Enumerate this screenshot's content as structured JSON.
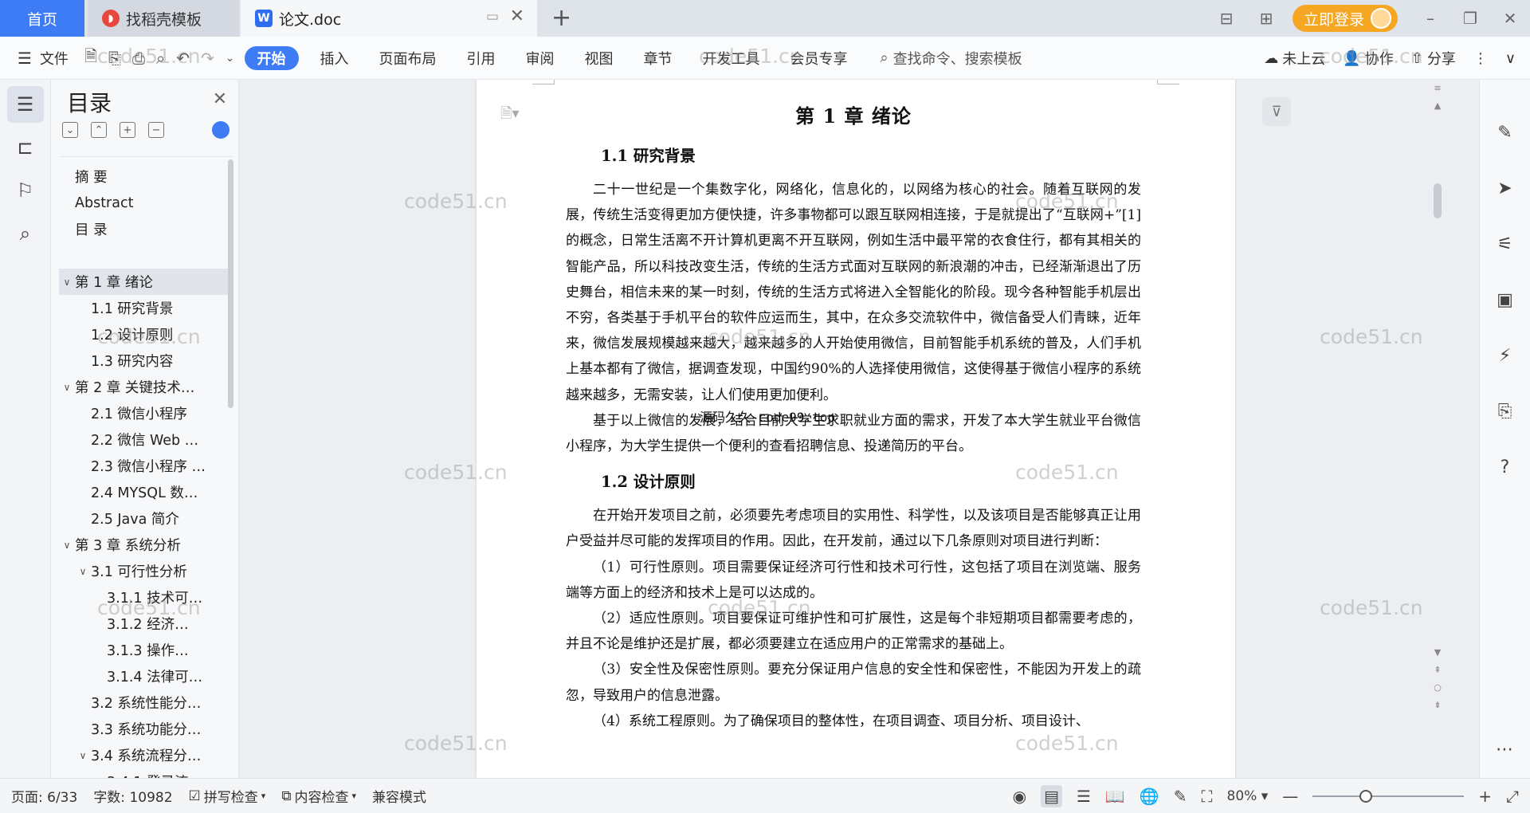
{
  "tabs": {
    "home": "首页",
    "daoke": "找稻壳模板",
    "doc": "论文.doc",
    "new_tab": "+"
  },
  "window": {
    "login": "立即登录"
  },
  "ribbon": {
    "file": "文件",
    "tabs": [
      "开始",
      "插入",
      "页面布局",
      "引用",
      "审阅",
      "视图",
      "章节",
      "开发工具",
      "会员专享"
    ],
    "search_placeholder": "查找命令、搜索模板",
    "cloud": "未上云",
    "collab": "协作",
    "share": "分享"
  },
  "toc": {
    "title": "目录",
    "items": [
      {
        "label": "摘  要",
        "level": 0,
        "arrow": ""
      },
      {
        "label": "Abstract",
        "level": 0,
        "arrow": ""
      },
      {
        "label": "目    录",
        "level": 0,
        "arrow": ""
      },
      {
        "label": "",
        "level": 0,
        "arrow": ""
      },
      {
        "label": "第 1 章   绪论",
        "level": 0,
        "arrow": "∨",
        "selected": true
      },
      {
        "label": "1.1 研究背景",
        "level": 1,
        "arrow": ""
      },
      {
        "label": "1.2 设计原则",
        "level": 1,
        "arrow": ""
      },
      {
        "label": "1.3 研究内容",
        "level": 1,
        "arrow": ""
      },
      {
        "label": "第 2 章   关键技术…",
        "level": 0,
        "arrow": "∨"
      },
      {
        "label": "2.1  微信小程序",
        "level": 1,
        "arrow": ""
      },
      {
        "label": "2.2 微信 Web  …",
        "level": 1,
        "arrow": ""
      },
      {
        "label": "2.3 微信小程序 …",
        "level": 1,
        "arrow": ""
      },
      {
        "label": "2.4 MYSQL 数…",
        "level": 1,
        "arrow": ""
      },
      {
        "label": "2.5 Java 简介",
        "level": 1,
        "arrow": ""
      },
      {
        "label": "第 3 章   系统分析",
        "level": 0,
        "arrow": "∨"
      },
      {
        "label": "3.1  可行性分析",
        "level": 1,
        "arrow": "∨"
      },
      {
        "label": "3.1.1 技术可…",
        "level": 2,
        "arrow": ""
      },
      {
        "label": "3.1.2  经济…",
        "level": 2,
        "arrow": ""
      },
      {
        "label": "3.1.3  操作…",
        "level": 2,
        "arrow": ""
      },
      {
        "label": "3.1.4 法律可…",
        "level": 2,
        "arrow": ""
      },
      {
        "label": "3.2  系统性能分…",
        "level": 1,
        "arrow": ""
      },
      {
        "label": "3.3  系统功能分…",
        "level": 1,
        "arrow": ""
      },
      {
        "label": "3.4  系统流程分…",
        "level": 1,
        "arrow": "∨"
      },
      {
        "label": "3.4.1 登录流…",
        "level": 2,
        "arrow": ""
      }
    ]
  },
  "document": {
    "chapter_title": "第 1 章    绪论",
    "sec1_title": "1.1 研究背景",
    "sec1_p1": "二十一世纪是一个集数字化，网络化，信息化的，以网络为核心的社会。随着互联网的发展，传统生活变得更加方便快捷，许多事物都可以跟互联网相连接，于是就提出了“互联网+”[1]的概念，日常生活离不开计算机更离不开互联网，例如生活中最平常的衣食住行，都有其相关的智能产品，所以科技改变生活，传统的生活方式面对互联网的新浪潮的冲击，已经渐渐退出了历史舞台，相信未来的某一时刻，传统的生活方式将进入全智能化的阶段。现今各种智能手机层出不穷，各类基于手机平台的软件应运而生，其中，在众多交流软件中，微信备受人们青睐，近年来，微信发展规模越来越大，越来越多的人开始使用微信，目前智能手机系统的普及，人们手机上基本都有了微信，据调查发现，中国约90%的人选择使用微信，这使得基于微信小程序的系统越来越多，无需安装，让人们使用更加便利。",
    "sec1_p2": "基于以上微信的发展，结合目前大学生求职就业方面的需求，开发了本大学生就业平台微信小程序，为大学生提供一个便利的查看招聘信息、投递简历的平台。",
    "sec2_title": "1.2 设计原则",
    "sec2_p1": "在开始开发项目之前，必须要先考虑项目的实用性、科学性，以及该项目是否能够真正让用户受益并尽可能的发挥项目的作用。因此，在开发前，通过以下几条原则对项目进行判断：",
    "sec2_i1": "（1）可行性原则。项目需要保证经济可行性和技术可行性，这包括了项目在浏览端、服务端等方面上的经济和技术上是可以达成的。",
    "sec2_i2": "（2）适应性原则。项目要保证可维护性和可扩展性，这是每个非短期项目都需要考虑的，并且不论是维护还是扩展，都必须要建立在适应用户的正常需求的基础上。",
    "sec2_i3": "（3）安全性及保密性原则。要充分保证用户信息的安全性和保密性，不能因为开发上的疏忽，导致用户的信息泄露。",
    "sec2_i4": "（4）系统工程原则。为了确保项目的整体性，在项目调查、项目分析、项目设计、",
    "overlay_note": "源码久久-code99.top"
  },
  "watermark": "code51.cn",
  "status": {
    "page": "页面: 6/33",
    "words": "字数: 10982",
    "spell": "拼写检查",
    "content_check": "内容检查",
    "compat": "兼容模式",
    "zoom": "80%",
    "zoom_level": 0.34
  }
}
